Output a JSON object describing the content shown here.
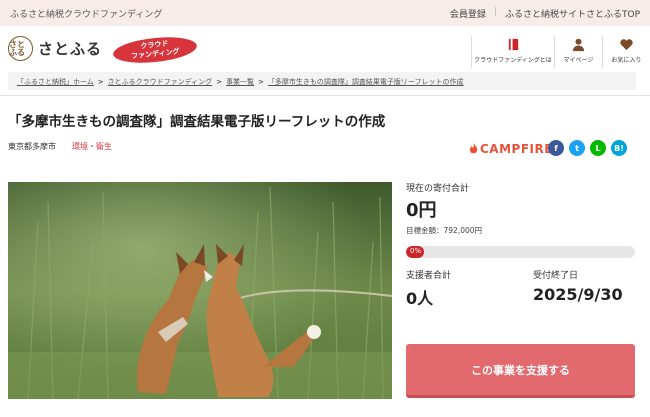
{
  "topbar": {
    "tagline": "ふるさと納税クラウドファンディング",
    "member_login": "会員登録",
    "site_top": "ふるさと納税サイトさとふるTOP"
  },
  "header": {
    "logo_seal": "さと ふる",
    "logo_text": "さとふる",
    "cf_badge_line1": "クラウド",
    "cf_badge_line2": "ファンディング",
    "nav": [
      {
        "label": "クラウドファンディングとは",
        "icon": "book-icon"
      },
      {
        "label": "マイページ",
        "icon": "person-icon"
      },
      {
        "label": "お気に入り",
        "icon": "heart-icon"
      }
    ]
  },
  "breadcrumb": [
    "「ふるさと納税」ホーム",
    "さとふるクラウドファンディング",
    "事業一覧",
    "「多摩市生きもの調査隊」調査結果電子版リーフレットの作成"
  ],
  "project": {
    "title": "「多摩市生きもの調査隊」調査結果電子版リーフレットの作成",
    "city": "東京都多摩市",
    "category": "環境・衛生",
    "campfire": "CAMPFIRE",
    "social": [
      {
        "name": "facebook",
        "glyph": "f",
        "color": "#3b5998"
      },
      {
        "name": "twitter",
        "glyph": "t",
        "color": "#1da1f2"
      },
      {
        "name": "line",
        "glyph": "L",
        "color": "#00b900"
      },
      {
        "name": "hatena",
        "glyph": "B!",
        "color": "#00a4de"
      }
    ]
  },
  "stats": {
    "current_label": "現在の寄付合計",
    "current_value": "0円",
    "goal_text": "目標金額：792,000円",
    "progress_pct": 0,
    "progress_label": "0%",
    "supporters_label": "支援者合計",
    "supporters_value": "0人",
    "deadline_label": "受付終了日",
    "deadline_value": "2025/9/30"
  },
  "cta": {
    "support_button": "この事業を支援する"
  },
  "colors": {
    "accent": "#d7353b",
    "cta": "#e26a6f",
    "campfire": "#e8533a"
  }
}
